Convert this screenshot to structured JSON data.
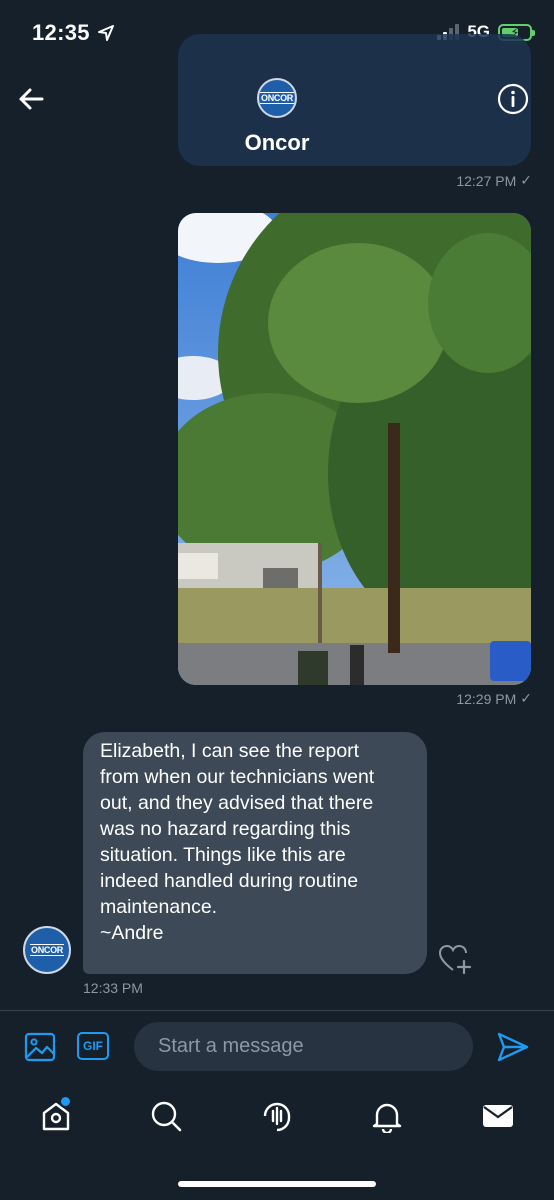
{
  "status_bar": {
    "time": "12:35",
    "network": "5G"
  },
  "header": {
    "name": "Oncor",
    "logo_text": "ONCOR"
  },
  "messages": [
    {
      "type": "image",
      "timestamp": "12:27 PM",
      "status": "✓"
    },
    {
      "type": "image",
      "timestamp": "12:29 PM",
      "status": "✓"
    },
    {
      "type": "text",
      "lines": [
        "Elizabeth, I can see the report",
        "from when our technicians went",
        "out, and they advised that there",
        "was no hazard regarding this",
        "situation. Things like this are",
        "indeed handled during routine",
        "maintenance.",
        "~Andre"
      ],
      "timestamp": "12:33 PM"
    }
  ],
  "composer": {
    "gif_label": "GIF",
    "placeholder": "Start a message"
  },
  "icons": {
    "back": "arrow-left-icon",
    "info": "info-icon",
    "like": "heart-plus-icon",
    "image": "image-icon",
    "send": "send-icon",
    "home": "home-icon",
    "search": "search-icon",
    "spaces": "spaces-icon",
    "notifications": "bell-icon",
    "messages": "mail-icon"
  },
  "colors": {
    "background": "#15202b",
    "accent": "#1d9bf0",
    "bubble_in": "#3d4957",
    "timestamp": "#8b98a5",
    "battery": "#5fd06a"
  }
}
